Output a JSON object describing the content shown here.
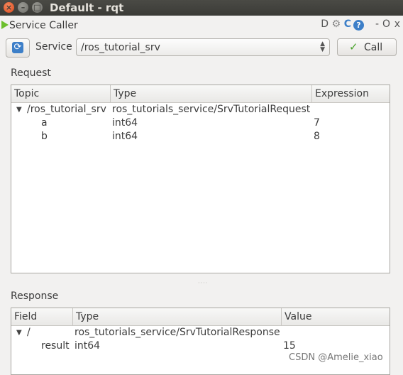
{
  "window": {
    "title": "Default - rqt",
    "close_glyph": "×",
    "min_glyph": "–",
    "max_glyph": "□"
  },
  "plugin": {
    "title": "Service Caller",
    "buttons": [
      "D",
      "⚙",
      "C",
      "?",
      "-",
      "O",
      "x"
    ]
  },
  "toolbar": {
    "service_label": "Service",
    "service_value": "/ros_tutorial_srv",
    "call_label": "Call"
  },
  "request": {
    "label": "Request",
    "columns": [
      "Topic",
      "Type",
      "Expression"
    ],
    "rows": [
      {
        "topic": "/ros_tutorial_srv",
        "type": "ros_tutorials_service/SrvTutorialRequest",
        "value": ""
      },
      {
        "topic": "a",
        "type": "int64",
        "value": "7"
      },
      {
        "topic": "b",
        "type": "int64",
        "value": "8"
      }
    ]
  },
  "response": {
    "label": "Response",
    "columns": [
      "Field",
      "Type",
      "Value"
    ],
    "rows": [
      {
        "topic": "/",
        "type": "ros_tutorials_service/SrvTutorialResponse",
        "value": ""
      },
      {
        "topic": "result",
        "type": "int64",
        "value": "15"
      }
    ]
  },
  "watermark": "CSDN @Amelie_xiao",
  "colors": {
    "accent_blue": "#3d7fc8",
    "call_check": "#4aa32c",
    "close_button": "#d9481c"
  }
}
